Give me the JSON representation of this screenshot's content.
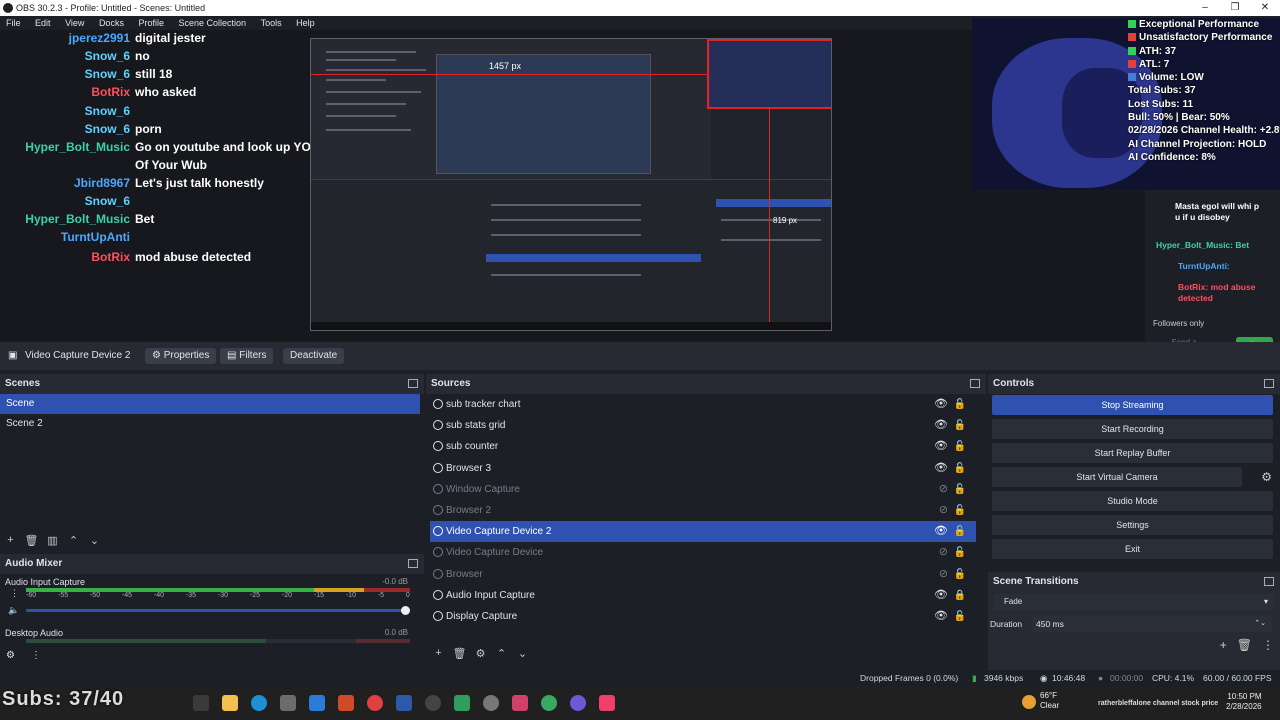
{
  "app": {
    "title": "OBS 30.2.3 - Profile: Untitled - Scenes: Untitled",
    "window_buttons": [
      "–",
      "❐",
      "✕"
    ]
  },
  "menu": [
    "File",
    "Edit",
    "View",
    "Docks",
    "Profile",
    "Scene Collection",
    "Tools",
    "Help"
  ],
  "overlay_chat": [
    {
      "user": "jperez2991",
      "msg": "digital jester",
      "color": "#4aa8ff"
    },
    {
      "user": "Snow_6",
      "msg": "no",
      "color": "#5fd1ff"
    },
    {
      "user": "Snow_6",
      "msg": "still 18",
      "color": "#5fd1ff"
    },
    {
      "user": "BotRix",
      "msg": "who asked",
      "color": "#ff4f5e"
    },
    {
      "user": "Snow_6",
      "msg": "",
      "color": "#5fd1ff"
    },
    {
      "user": "Snow_6",
      "msg": "porn",
      "color": "#5fd1ff"
    },
    {
      "user": "Hyper_Bolt_Music",
      "msg": "Go on youtube and look up YOOKIE - Sunshine",
      "color": "#3fd0a8"
    },
    {
      "user": "",
      "msg": "Of Your Wub",
      "color": "#3fd0a8"
    },
    {
      "user": "Jbird8967",
      "msg": "Let's just talk honestly",
      "color": "#4aa8ff"
    },
    {
      "user": "Snow_6",
      "msg": "",
      "color": "#5fd1ff"
    },
    {
      "user": "Hyper_Bolt_Music",
      "msg": "Bet",
      "color": "#3fd0a8"
    },
    {
      "user": "TurntUpAnti",
      "msg": "",
      "color": "#4aa8ff"
    },
    {
      "user": "BotRix",
      "msg": "mod abuse detected",
      "color": "#ff4f5e"
    }
  ],
  "preview_labels": {
    "px_width": "1457 px",
    "px_height": "819 px"
  },
  "stats": {
    "lines": [
      {
        "text": "Exceptional Performance",
        "square": "#34d058"
      },
      {
        "text": "Unsatisfactory Performance",
        "square": "#e0413a"
      },
      {
        "text": "ATH: 37",
        "square": "#34d058"
      },
      {
        "text": "ATL: 7",
        "square": "#e0413a"
      },
      {
        "text": "Volume: LOW",
        "square": "#4a7bd6"
      },
      {
        "text": "Total Subs: 37",
        "square": ""
      },
      {
        "text": "Lost Subs: 11",
        "square": ""
      },
      {
        "text": "Bull: 50% | Bear: 50%",
        "square": ""
      },
      {
        "text": "02/28/2026 Channel Health: +2.8%",
        "square": ""
      },
      {
        "text": "AI Channel Projection: HOLD",
        "square": ""
      },
      {
        "text": "AI Confidence: 8%",
        "square": ""
      }
    ]
  },
  "side_chat": {
    "mod_note": "Masta egol will whi p u if u disobey",
    "msgs": [
      {
        "text": "Hyper_Bolt_Music: Bet"
      },
      {
        "text": "TurntUpAnti:"
      },
      {
        "text": "BotRix: mod abuse detected"
      }
    ],
    "followers": "Followers only",
    "send_placeholder": "Send a message",
    "chat_button": "Chat"
  },
  "source_toolbar": {
    "selected": "Video Capture Device 2",
    "properties": "Properties",
    "filters": "Filters",
    "deactivate": "Deactivate"
  },
  "scenes": {
    "title": "Scenes",
    "items": [
      {
        "name": "Scene",
        "selected": true
      },
      {
        "name": "Scene 2",
        "selected": false
      }
    ]
  },
  "sources": {
    "title": "Sources",
    "items": [
      {
        "name": "sub tracker chart",
        "visible": true,
        "locked": false
      },
      {
        "name": "sub stats grid",
        "visible": true,
        "locked": false
      },
      {
        "name": "sub counter",
        "visible": true,
        "locked": false
      },
      {
        "name": "Browser 3",
        "visible": true,
        "locked": false
      },
      {
        "name": "Window Capture",
        "visible": false,
        "locked": false
      },
      {
        "name": "Browser 2",
        "visible": false,
        "locked": false
      },
      {
        "name": "Video Capture Device 2",
        "visible": true,
        "locked": false,
        "selected": true
      },
      {
        "name": "Video Capture Device",
        "visible": false,
        "locked": false
      },
      {
        "name": "Browser",
        "visible": false,
        "locked": false
      },
      {
        "name": "Audio Input Capture",
        "visible": true,
        "locked": true
      },
      {
        "name": "Display Capture",
        "visible": true,
        "locked": false
      }
    ]
  },
  "mixer": {
    "title": "Audio Mixer",
    "tracks": [
      {
        "name": "Audio Input Capture",
        "db": "-0.0 dB",
        "level": 0.92
      },
      {
        "name": "Desktop Audio",
        "db": "0.0 dB",
        "level": 0.0
      }
    ],
    "ticks": [
      "-60",
      "-55",
      "-50",
      "-45",
      "-40",
      "-35",
      "-30",
      "-25",
      "-20",
      "-15",
      "-10",
      "-5",
      "0"
    ]
  },
  "controls": {
    "title": "Controls",
    "buttons": [
      "Stop Streaming",
      "Start Recording",
      "Start Replay Buffer",
      "Start Virtual Camera",
      "Studio Mode",
      "Settings",
      "Exit"
    ]
  },
  "transitions": {
    "title": "Scene Transitions",
    "selected": "Fade",
    "duration_label": "Duration",
    "duration": "450 ms"
  },
  "status": {
    "dropped": "Dropped Frames 0 (0.0%)",
    "kbps": "3946 kbps",
    "stream_time": "10:46:48",
    "rec_time": "00:00:00",
    "cpu": "CPU: 4.1%",
    "fps": "60.00 / 60.00 FPS"
  },
  "taskbar": {
    "ticker": "Subs: 37/40",
    "weather_temp": "66°F",
    "weather_desc": "Clear",
    "ticker2": "ratherbleffalone channel stock price",
    "time": "10:50 PM",
    "date": "2/28/2026"
  }
}
